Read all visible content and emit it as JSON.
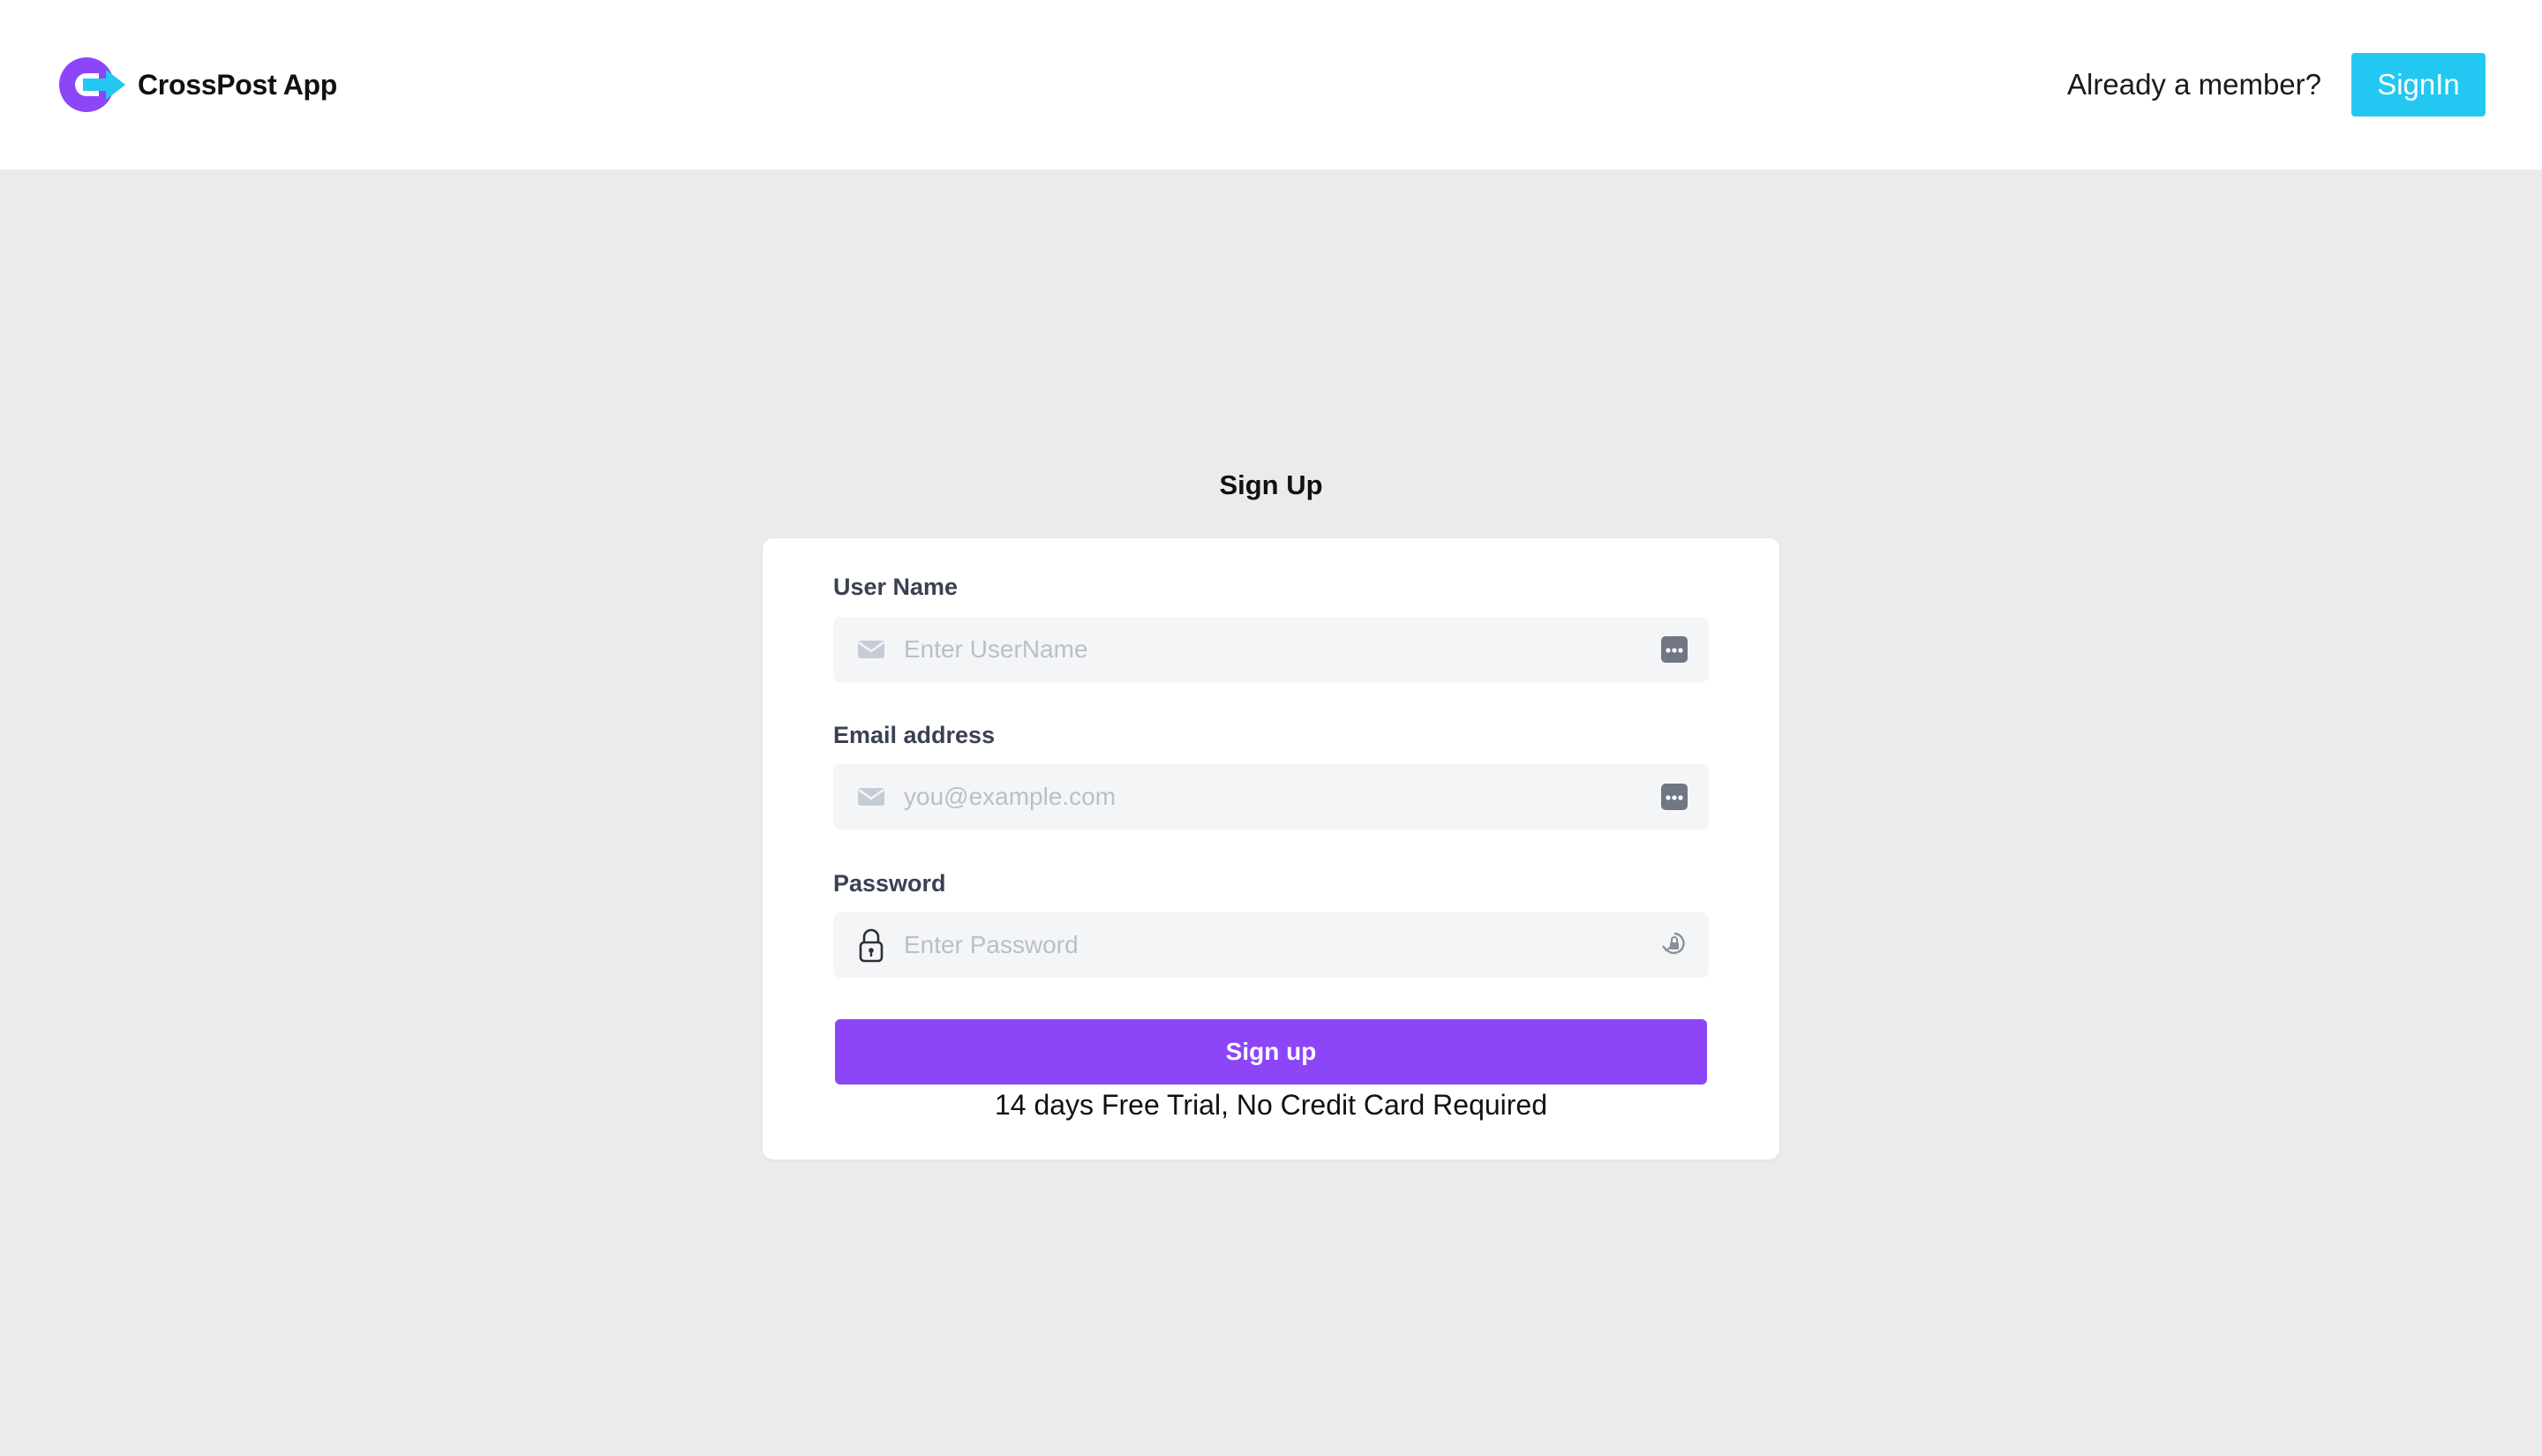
{
  "header": {
    "brand_name": "CrossPost App",
    "member_prompt": "Already a member?",
    "signin_label": "SignIn"
  },
  "page": {
    "title": "Sign Up"
  },
  "form": {
    "username": {
      "label": "User Name",
      "placeholder": "Enter UserName",
      "value": ""
    },
    "email": {
      "label": "Email address",
      "placeholder": "you@example.com",
      "value": ""
    },
    "password": {
      "label": "Password",
      "placeholder": "Enter Password",
      "value": ""
    },
    "submit_label": "Sign up",
    "trial_note": "14 days Free Trial, No Credit Card Required"
  },
  "icons": {
    "brand_logo": "crosspost-logo-icon",
    "username_lead": "envelope-icon",
    "username_trail": "password-manager-icon",
    "email_lead": "envelope-icon",
    "email_trail": "password-manager-icon",
    "password_lead": "padlock-icon",
    "password_trail": "password-key-icon"
  },
  "colors": {
    "brand_purple": "#8c45f7",
    "brand_cyan": "#22c8f2",
    "header_bg": "#ffffff",
    "page_bg": "#ebebeb"
  }
}
